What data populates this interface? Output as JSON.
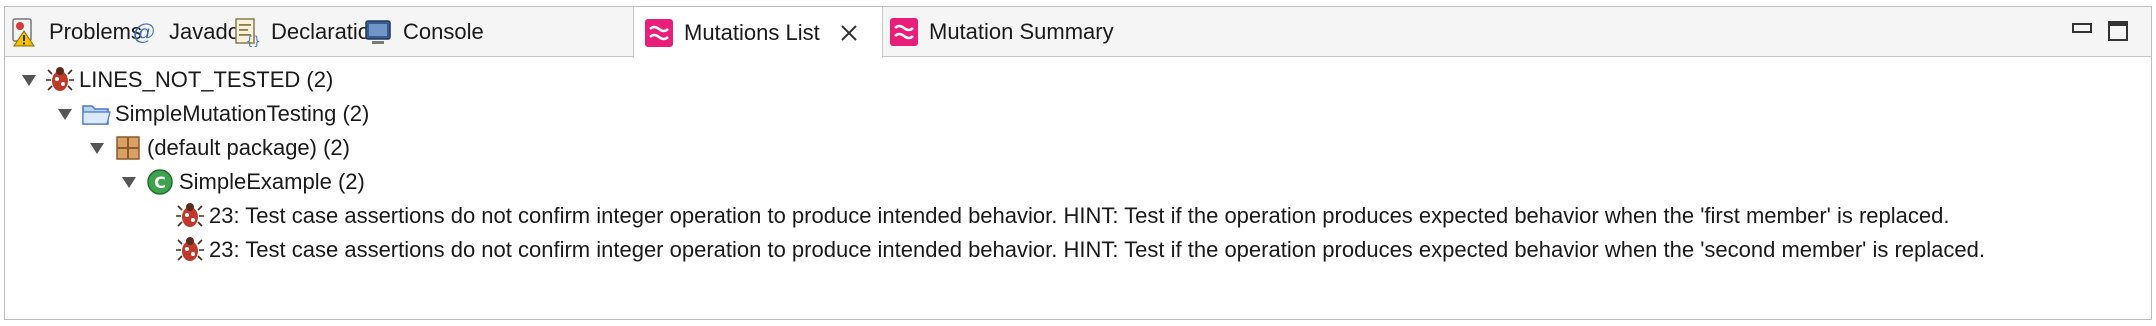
{
  "tabs": [
    {
      "label": "Problems",
      "icon": "problems-icon"
    },
    {
      "label": "Javadoc",
      "icon": "javadoc-icon"
    },
    {
      "label": "Declaration",
      "icon": "declaration-icon"
    },
    {
      "label": "Console",
      "icon": "console-icon"
    },
    {
      "label": "Mutations List",
      "icon": "mutation-icon",
      "active": true
    },
    {
      "label": "Mutation Summary",
      "icon": "mutation-icon"
    }
  ],
  "tree": {
    "root": {
      "label": "LINES_NOT_TESTED (2)",
      "icon": "bug-icon"
    },
    "project": {
      "label": "SimpleMutationTesting (2)",
      "icon": "folder-icon"
    },
    "package": {
      "label": "(default package) (2)",
      "icon": "package-icon"
    },
    "class": {
      "label": "SimpleExample (2)",
      "icon": "class-icon"
    },
    "items": [
      {
        "label": "23: Test case assertions do not confirm integer operation to produce intended behavior. HINT: Test if the operation produces expected behavior when the 'first member' is replaced.",
        "icon": "bug-icon"
      },
      {
        "label": "23: Test case assertions do not confirm integer operation to produce intended behavior. HINT: Test if the operation produces expected behavior when the 'second member' is replaced.",
        "icon": "bug-icon"
      }
    ]
  },
  "colors": {
    "accent": "#e91e7a",
    "tab_bg": "#f5f5f5",
    "border": "#c8c8c8"
  }
}
